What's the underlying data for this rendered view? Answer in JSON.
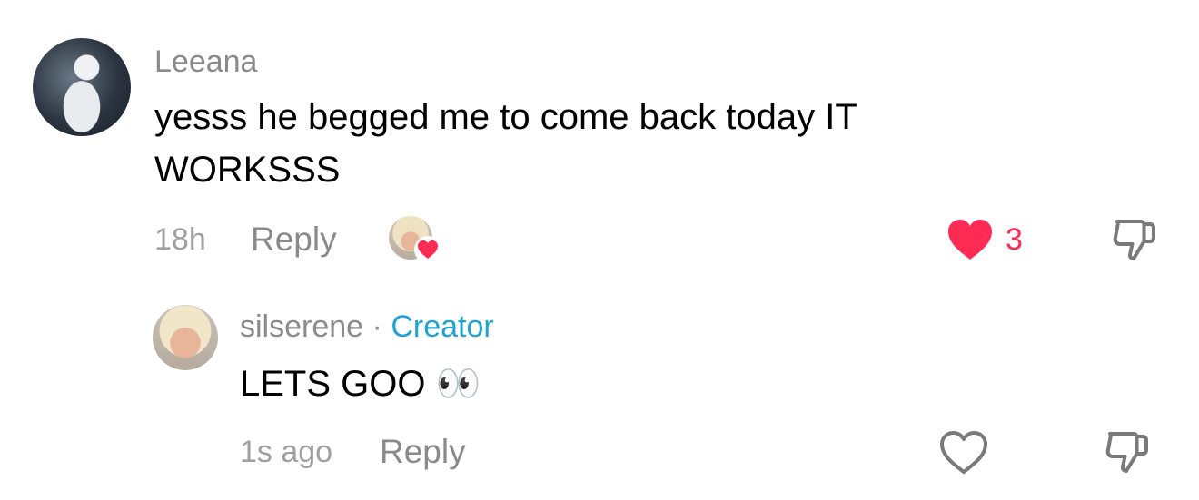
{
  "comment": {
    "username": "Leeana",
    "text_line1": "yesss he begged me to come back today IT",
    "text_line2": "WORKSSS",
    "time": "18h",
    "reply_label": "Reply",
    "like_count": "3",
    "liked": true,
    "icons": {
      "like": "heart-filled-icon",
      "dislike": "thumbs-down-icon",
      "liked_by_creator": "heart-badge-icon"
    }
  },
  "reply": {
    "username": "silserene",
    "separator": "·",
    "badge": "Creator",
    "text": "LETS GOO",
    "emoji": "👀",
    "time": "1s ago",
    "reply_label": "Reply",
    "liked": false,
    "icons": {
      "like": "heart-outline-icon",
      "dislike": "thumbs-down-icon"
    }
  },
  "colors": {
    "like_active": "#fe2c55",
    "creator_badge": "#20a4cf",
    "secondary_text": "#8a8a8a"
  }
}
